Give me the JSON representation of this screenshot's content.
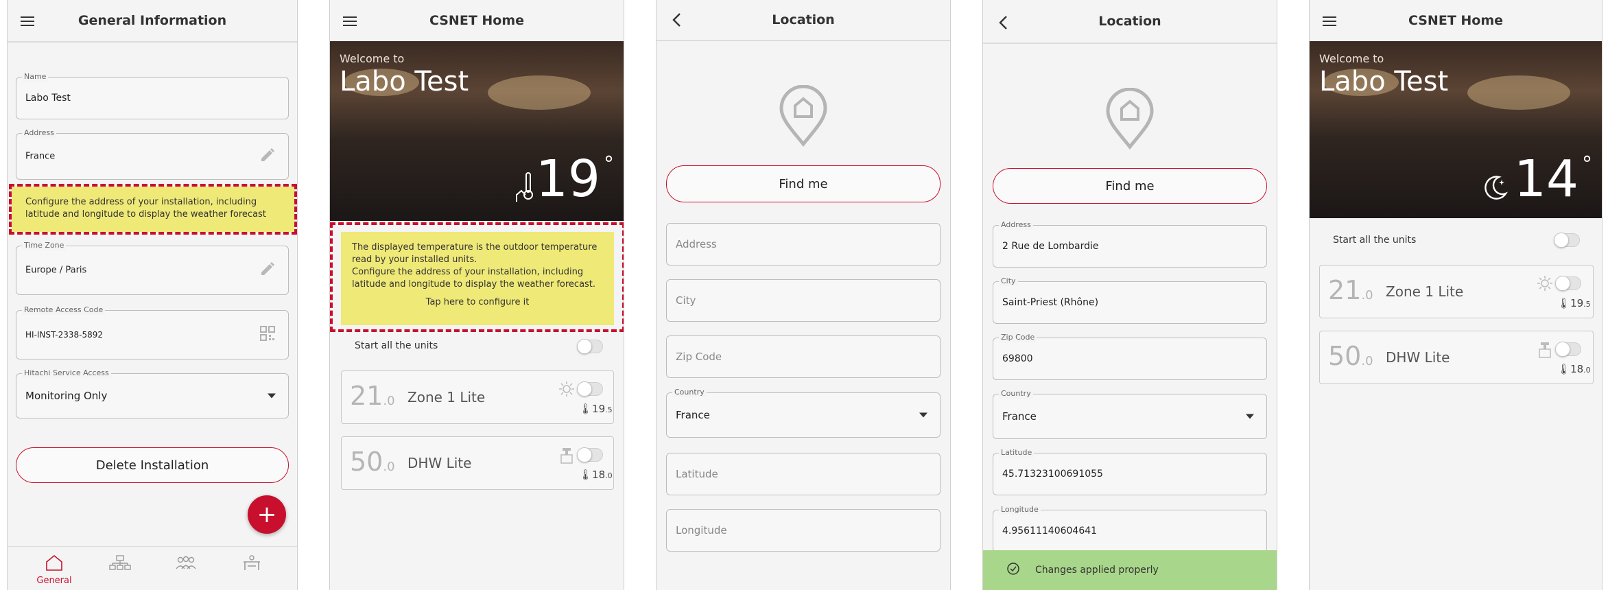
{
  "colors": {
    "accent": "#c8102e",
    "tip": "#efe977",
    "toast": "#a8d68a"
  },
  "general": {
    "title": "General Information",
    "name": {
      "label": "Name",
      "value": "Labo Test"
    },
    "address": {
      "label": "Address",
      "value": "France"
    },
    "tip": "Configure the address of your installation, including latitude and longitude to display the weather forecast",
    "timezone": {
      "label": "Time Zone",
      "value": "Europe / Paris"
    },
    "remote": {
      "label": "Remote Access Code",
      "value": "HI-INST-2338-5892"
    },
    "service": {
      "label": "Hitachi Service Access",
      "value": "Monitoring Only"
    },
    "delete_label": "Delete Installation",
    "fab_label": "+",
    "nav": {
      "general_label": "General"
    },
    "icons": {
      "edit": "pencil-icon",
      "qr": "qr-code-icon",
      "home": "home-icon",
      "units": "units-icon",
      "users": "users-icon",
      "installer": "installer-icon"
    }
  },
  "home1": {
    "title": "CSNET Home",
    "welcome": "Welcome to",
    "name": "Labo Test",
    "temp": "19",
    "deg": "°",
    "tip_lines": [
      "The displayed temperature is the outdoor temperature read by your installed units.",
      "Configure the address of your installation, including latitude and longitude to display the weather forecast.",
      "Tap here to configure it"
    ],
    "start_all": "Start all the units",
    "units": [
      {
        "big": "21",
        "dec": ".0",
        "name": "Zone 1 Lite",
        "temp": "19",
        "tdec": ".5",
        "icon": "sun-icon"
      },
      {
        "big": "50",
        "dec": ".0",
        "name": "DHW Lite",
        "temp": "18",
        "tdec": ".0",
        "icon": "tap-icon"
      }
    ]
  },
  "location1": {
    "title": "Location",
    "find_me": "Find me",
    "address_ph": "Address",
    "city_ph": "City",
    "zip_ph": "Zip Code",
    "country": {
      "label": "Country",
      "value": "France"
    },
    "lat_ph": "Latitude",
    "lon_ph": "Longitude"
  },
  "location2": {
    "title": "Location",
    "find_me": "Find me",
    "address": {
      "label": "Address",
      "value": "2 Rue de Lombardie"
    },
    "city": {
      "label": "City",
      "value": "Saint-Priest (Rhône)"
    },
    "zip": {
      "label": "Zip Code",
      "value": "69800"
    },
    "country": {
      "label": "Country",
      "value": "France"
    },
    "lat": {
      "label": "Latitude",
      "value": "45.71323100691055"
    },
    "lon": {
      "label": "Longitude",
      "value": "4.95611140604641"
    },
    "toast": "Changes applied properly"
  },
  "home2": {
    "title": "CSNET Home",
    "welcome": "Welcome to",
    "name": "Labo Test",
    "temp": "14",
    "deg": "°",
    "start_all": "Start all the units",
    "units": [
      {
        "big": "21",
        "dec": ".0",
        "name": "Zone 1 Lite",
        "temp": "19",
        "tdec": ".5",
        "icon": "sun-icon"
      },
      {
        "big": "50",
        "dec": ".0",
        "name": "DHW Lite",
        "temp": "18",
        "tdec": ".0",
        "icon": "tap-icon"
      }
    ]
  }
}
